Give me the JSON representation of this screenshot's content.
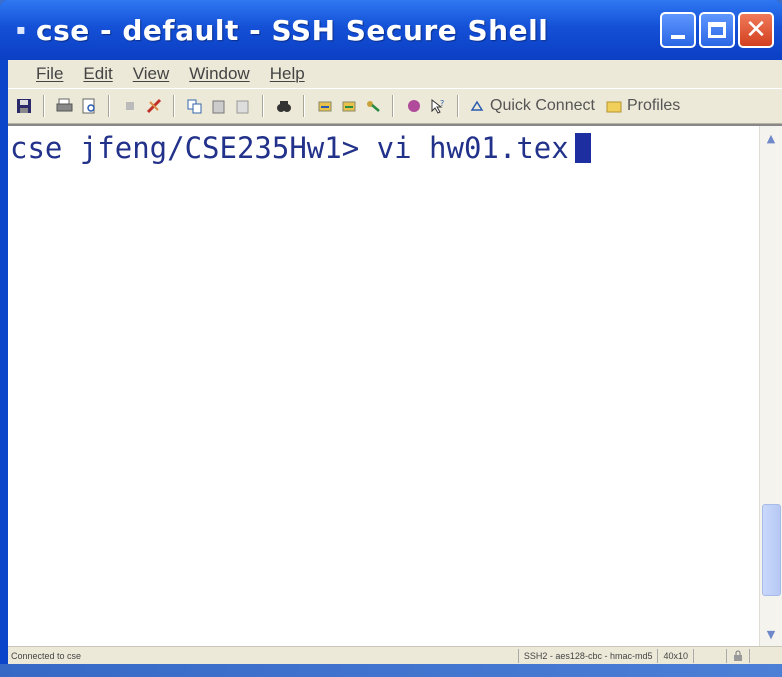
{
  "window": {
    "title": "cse - default - SSH Secure Shell",
    "buttons": {
      "minimize": "",
      "maximize": "",
      "close": "✕"
    }
  },
  "menu": [
    "File",
    "Edit",
    "View",
    "Window",
    "Help"
  ],
  "toolbar": {
    "icons": [
      "save-icon",
      "print-icon",
      "print-preview-icon",
      "settings-icon",
      "disconnect-icon",
      "copy-icon",
      "paste-icon",
      "paste-special-icon",
      "find-icon",
      "sftp-icon",
      "sftp2-icon",
      "keys-icon",
      "connect-icon",
      "help-icon"
    ],
    "quick_connect": "Quick Connect",
    "profiles": "Profiles"
  },
  "terminal": {
    "prompt": "cse jfeng/CSE235Hw1>",
    "command": "vi hw01.tex"
  },
  "status": {
    "left": "Connected to cse",
    "cipher": "SSH2 - aes128-cbc - hmac-md5",
    "size": "40x10"
  },
  "colors": {
    "title_bar": "#1450d6",
    "terminal_text": "#22318a",
    "cursor": "#1d2fa0"
  }
}
